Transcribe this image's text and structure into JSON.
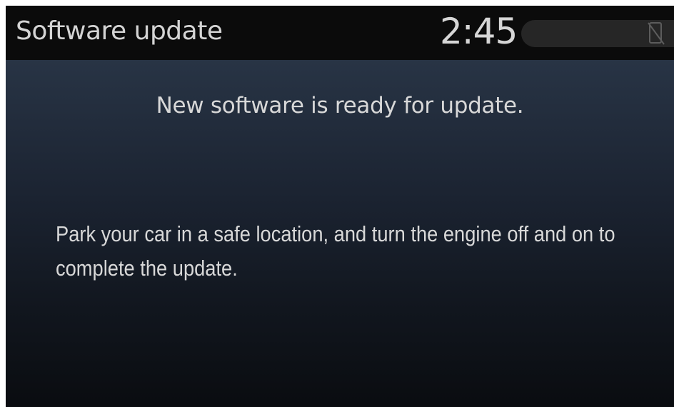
{
  "header": {
    "title": "Software update",
    "clock": "2:45",
    "status_icon": "phone-disconnected-icon"
  },
  "main": {
    "headline": "New software is ready for update.",
    "instruction": "Park your car in a safe location, and turn the engine off and on to complete the update."
  },
  "colors": {
    "header_bg": "#0b0b0b",
    "content_gradient_top": "#283445",
    "content_gradient_bottom": "#0a0c10",
    "text": "#d8d8d8"
  }
}
